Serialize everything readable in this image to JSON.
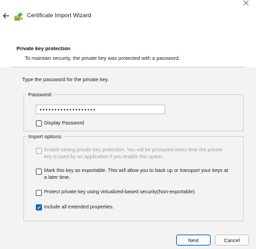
{
  "window": {
    "title": "Certificate Import Wizard",
    "close_glyph": "✕"
  },
  "header": {
    "title": "Private key protection",
    "subtitle": "To maintain security, the private key was protected with a password."
  },
  "main": {
    "instruction": "Type the password for the private key.",
    "password_group_label": "Password:",
    "password_value": "•••••••••••••••••••",
    "display_password_label": "Display Password",
    "import_options_label": "Import options:",
    "options": [
      {
        "label": "Enable strong private key protection. You will be prompted every time the private key is used by an application if you enable this option.",
        "checked": false,
        "enabled": false
      },
      {
        "label": "Mark this key as exportable. This will allow you to back up or transport your keys at a later time.",
        "checked": false,
        "enabled": true
      },
      {
        "label": "Protect private key using virtualized-based security(Non-exportable)",
        "checked": false,
        "enabled": true
      },
      {
        "label": "Include all extended properties.",
        "checked": true,
        "enabled": true
      }
    ]
  },
  "footer": {
    "next_label": "Next",
    "cancel_label": "Cancel"
  },
  "colors": {
    "accent": "#0067c0",
    "content_bg": "#f3f3f3"
  },
  "icons": [
    "close-icon",
    "back-arrow-icon",
    "certificate-wizard-icon",
    "checkmark-icon"
  ]
}
